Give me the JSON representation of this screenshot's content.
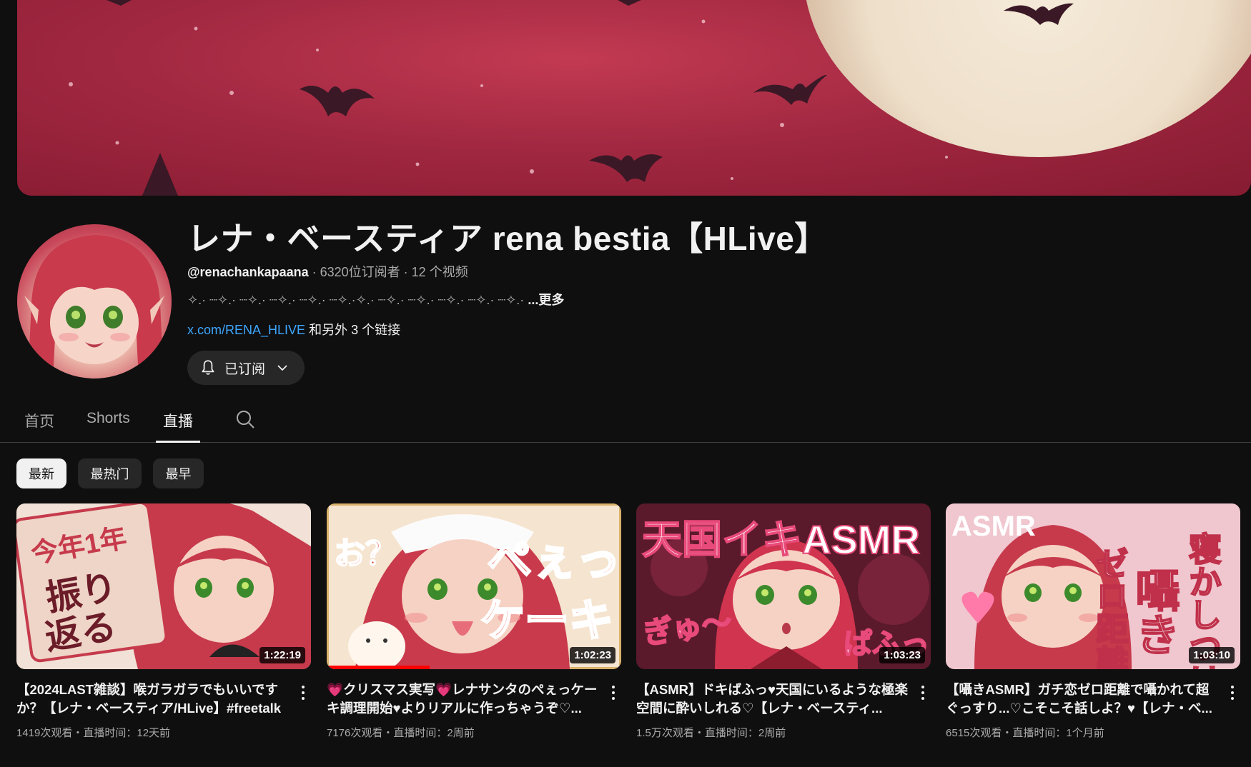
{
  "channel": {
    "title": "レナ・ベースティア rena bestia【HLive】",
    "handle": "@renachankapaana",
    "stats": " · 6320位订阅者 · 12 个视频",
    "description": "✧.· ┈✧.· ┈✧.· ┈✧.· ┈✧.· ┈✧.·✧.· ┈✧.· ┈✧.· ┈✧.· ┈✧.· ┈✧.· ",
    "more_label": "...更多",
    "link_text": "x.com/RENA_HLIVE",
    "extra_links_text": " 和另外 3 个链接",
    "subscribe_label": "已订阅"
  },
  "tabs": [
    {
      "label": "首页"
    },
    {
      "label": "Shorts"
    },
    {
      "label": "直播"
    }
  ],
  "chips": [
    {
      "label": "最新"
    },
    {
      "label": "最热门"
    },
    {
      "label": "最早"
    }
  ],
  "videos": [
    {
      "title": "【2024LAST雑談】喉ガラガラでもいいですか？【レナ・ベースティア/HLive】#freetalk",
      "meta": "1419次观看・直播时间：12天前",
      "duration": "1:22:19",
      "thumb_caption": "今年1年 振り返る"
    },
    {
      "title": "💗クリスマス実写💗レナサンタのぺぇっケーキ調理開始♥よりリアルに作っちゃうぞ♡...",
      "meta": "7176次观看・直播时间：2周前",
      "duration": "1:02:23",
      "thumb_caption": "お？ ぺぇっ ケーキ",
      "progress": 0.35
    },
    {
      "title": "【ASMR】ドキばふっ♥天国にいるような極楽空間に酔いしれる♡【レナ・ベースティ...",
      "meta": "1.5万次观看・直播时间：2周前",
      "duration": "1:03:23",
      "thumb_caption": "天国イキASMR ぎゅ〜 ぱふっ♡"
    },
    {
      "title": "【囁きASMR】ガチ恋ゼロ距離で囁かれて超ぐっすり...♡こそこそ話しよ？♥【レナ・ベ...",
      "meta": "6515次观看・直播时间：1个月前",
      "duration": "1:03:10",
      "thumb_caption": "ASMR ゼロ距離 囁き 寝かしつけ"
    }
  ],
  "colors": {
    "background": "#0f0f0f",
    "link": "#3ea6ff",
    "banner_red": "#a22841",
    "moon": "#f0e2cd",
    "progress_red": "#ff0000"
  },
  "icons": [
    "bell-icon",
    "chevron-down-icon",
    "search-icon",
    "more-vert-icon"
  ]
}
